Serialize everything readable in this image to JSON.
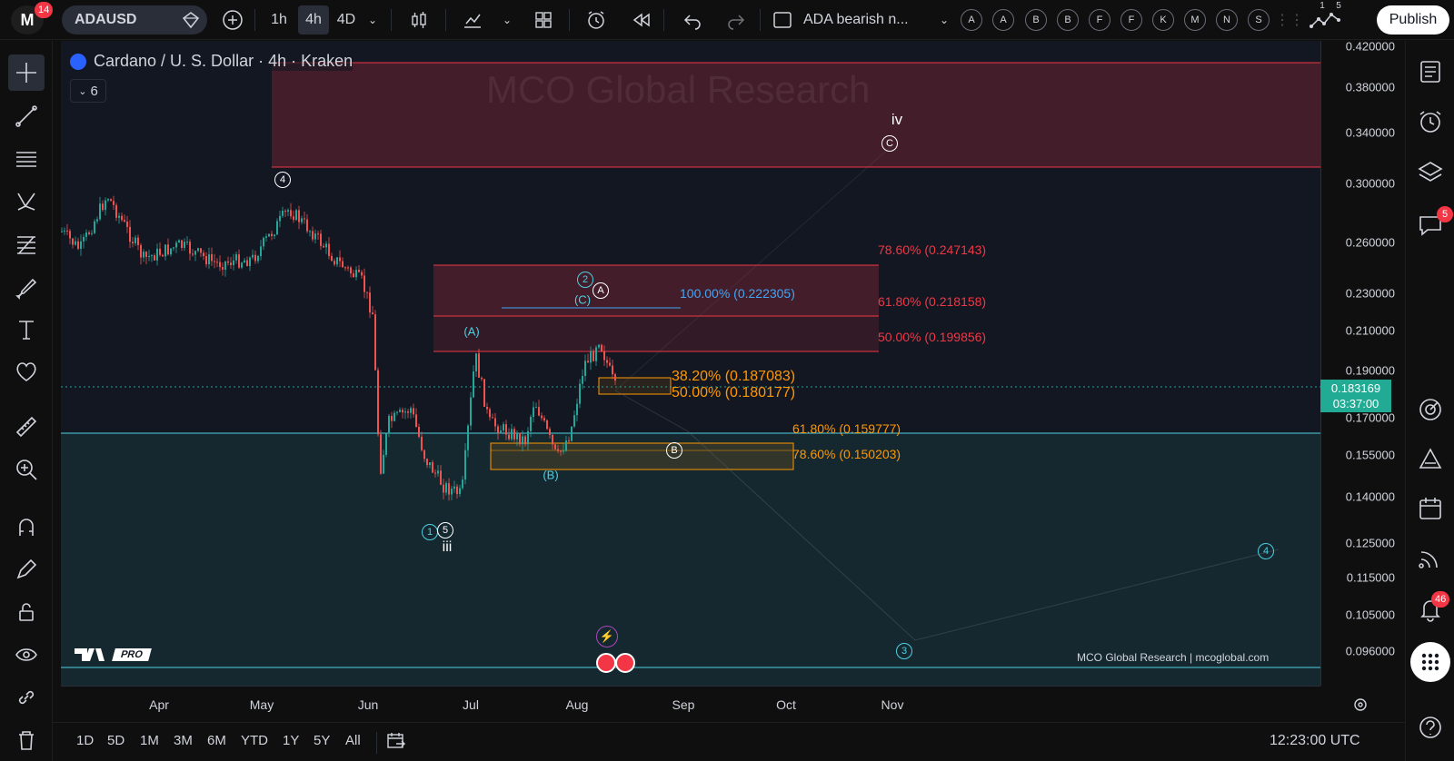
{
  "topbar": {
    "logo_letter": "M",
    "logo_badge": "14",
    "symbol": "ADAUSD",
    "intervals": [
      "1h",
      "4h",
      "4D"
    ],
    "active_interval": "4h",
    "layout_name": "ADA bearish n...",
    "letter_buttons": [
      "A",
      "A",
      "B",
      "B",
      "F",
      "F",
      "K",
      "M",
      "N",
      "S"
    ],
    "alerts_badges": [
      "1",
      "5"
    ],
    "publish_label": "Publish"
  },
  "legend": {
    "title": "Cardano / U. S. Dollar · 4h · Kraken",
    "collapsed_count": "6"
  },
  "watermark": "MCO Global Research",
  "credit": "MCO Global Research | mcoglobal.com",
  "tv_logo_pro": "PRO",
  "price_axis": {
    "ticks": [
      "0.420000",
      "0.380000",
      "0.340000",
      "0.300000",
      "0.260000",
      "0.230000",
      "0.210000",
      "0.190000",
      "0.170000",
      "0.155000",
      "0.140000",
      "0.125000",
      "0.115000",
      "0.105000",
      "0.096000"
    ],
    "current_price": "0.183169",
    "countdown": "03:37:00"
  },
  "time_axis": {
    "ticks": [
      "Apr",
      "May",
      "Jun",
      "Jul",
      "Aug",
      "Sep",
      "Oct",
      "Nov"
    ]
  },
  "fib_levels": {
    "red": [
      "78.60% (0.247143)",
      "61.80% (0.218158)",
      "50.00% (0.199856)"
    ],
    "blue": [
      "100.00% (0.222305)"
    ],
    "orange_large": [
      "38.20% (0.187083)",
      "50.00% (0.180177)"
    ],
    "orange_small": [
      "61.80% (0.159777)",
      "78.60% (0.150203)"
    ]
  },
  "wave_labels": {
    "iv": "iv",
    "C_big": "C",
    "four_top": "4",
    "two_blue": "2",
    "A_circ": "A",
    "C_paren": "(C)",
    "A_paren": "(A)",
    "B_circ": "B",
    "B_paren": "(B)",
    "one_blue": "1",
    "five": "5",
    "iii": "iii",
    "four_blue": "4",
    "three_blue": "3"
  },
  "bottom": {
    "ranges": [
      "1D",
      "5D",
      "1M",
      "3M",
      "6M",
      "YTD",
      "1Y",
      "5Y",
      "All"
    ],
    "time": "12:23:00 UTC"
  },
  "right_badges": {
    "chat": "5",
    "notifications": "46"
  },
  "colors": {
    "bg": "#131722",
    "red_zone": "#f23645",
    "teal_zone": "#26a69a",
    "orange": "#ff9800",
    "candle_up": "#26a69a",
    "candle_down": "#ef5350"
  }
}
